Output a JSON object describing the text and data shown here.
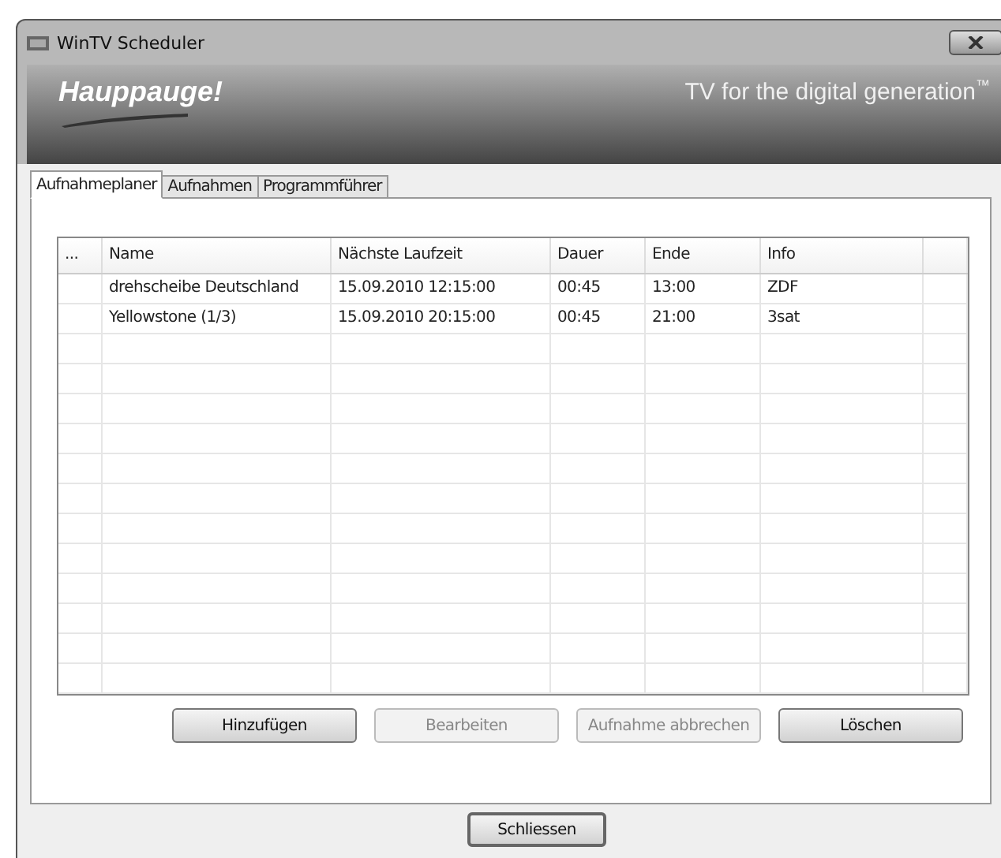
{
  "window": {
    "title": "WinTV Scheduler"
  },
  "banner": {
    "logo": "Hauppauge!",
    "tagline": "TV for the digital generation",
    "trademark": "™"
  },
  "tabs": [
    {
      "label": "Aufnahmeplaner",
      "selected": true
    },
    {
      "label": "Aufnahmen",
      "selected": false
    },
    {
      "label": "Programmführer",
      "selected": false
    }
  ],
  "table": {
    "columns": [
      "...",
      "Name",
      "Nächste Laufzeit",
      "Dauer",
      "Ende",
      "Info"
    ],
    "rows": [
      [
        "",
        "drehscheibe Deutschland",
        "15.09.2010 12:15:00",
        "00:45",
        "13:00",
        "ZDF"
      ],
      [
        "",
        "Yellowstone (1/3)",
        "15.09.2010 20:15:00",
        "00:45",
        "21:00",
        "3sat"
      ]
    ]
  },
  "buttons": [
    {
      "label": "Hinzufügen",
      "disabled": false
    },
    {
      "label": "Bearbeiten",
      "disabled": true
    },
    {
      "label": "Aufnahme abbrechen",
      "disabled": true
    },
    {
      "label": "Löschen",
      "disabled": false
    }
  ],
  "close_button": {
    "label": "Schliessen"
  }
}
